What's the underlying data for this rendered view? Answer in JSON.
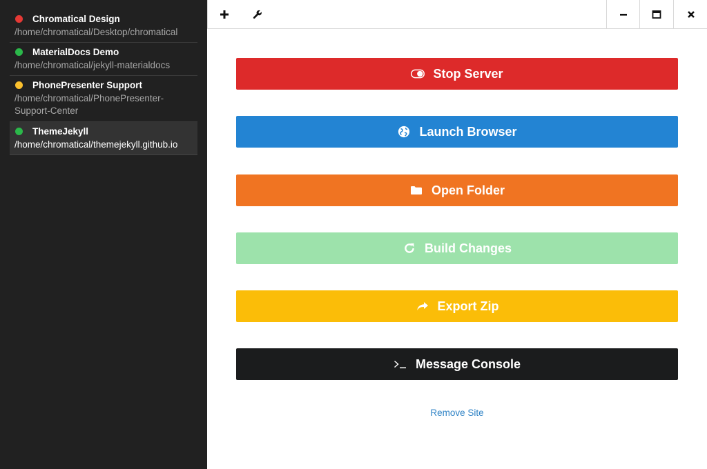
{
  "colors": {
    "sidebar_bg": "#212121",
    "status_red": "#e53935",
    "status_green": "#2bb84a",
    "status_yellow": "#fbc02d",
    "stop": "#dd2a2a",
    "launch": "#2384d3",
    "open": "#f07422",
    "build": "#9de2ab",
    "export": "#fbbd08",
    "console": "#1b1c1d",
    "link": "#2f83c6"
  },
  "sites": [
    {
      "name": "Chromatical Design",
      "path": "/home/chromatical/Desktop/chromatical",
      "status": "red"
    },
    {
      "name": "MaterialDocs Demo",
      "path": "/home/chromatical/jekyll-materialdocs",
      "status": "green"
    },
    {
      "name": "PhonePresenter Support",
      "path": "/home/chromatical/PhonePresenter-Support-Center",
      "status": "yellow"
    },
    {
      "name": "ThemeJekyll",
      "path": "/home/chromatical/themejekyll.github.io",
      "status": "green"
    }
  ],
  "toolbar": {
    "add_icon": "plus-icon",
    "settings_icon": "wrench-icon",
    "minimize_icon": "minimize-icon",
    "maximize_icon": "maximize-icon",
    "close_icon": "close-icon"
  },
  "actions": {
    "stop_server": "Stop Server",
    "launch_browser": "Launch Browser",
    "open_folder": "Open Folder",
    "build_changes": "Build Changes",
    "export_zip": "Export Zip",
    "message_console": "Message Console"
  },
  "remove_site": "Remove Site"
}
